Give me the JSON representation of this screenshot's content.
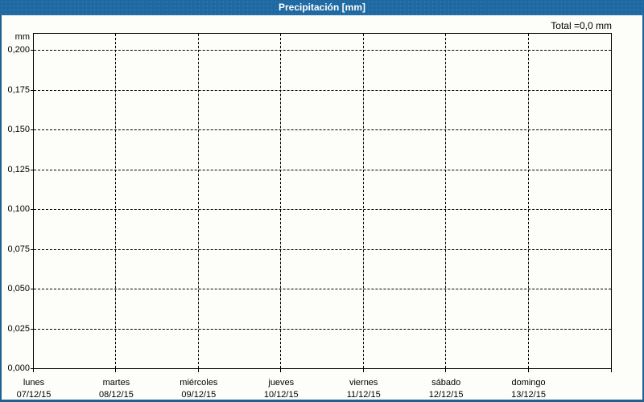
{
  "window": {
    "title": "Precipitación [mm]"
  },
  "summary": {
    "total_label": "Total =0,0 mm"
  },
  "colors": {
    "titlebar": "#1e69a2",
    "frame_border": "#20618f",
    "content_bg": "#fdfdfa",
    "grid": "#000000",
    "title_text": "#ffffff",
    "label_text": "#000000"
  },
  "chart_data": {
    "type": "bar",
    "title": "Precipitación [mm]",
    "ylabel": "mm",
    "xlabel": "",
    "ylim": [
      0,
      0.2
    ],
    "ytick_step": 0.025,
    "ytick_labels": [
      "0,000",
      "0,025",
      "0,050",
      "0,075",
      "0,100",
      "0,125",
      "0,150",
      "0,175",
      "0,200"
    ],
    "categories": [
      "lunes",
      "martes",
      "miércoles",
      "jueves",
      "viernes",
      "sábado",
      "domingo"
    ],
    "category_dates": [
      "07/12/15",
      "08/12/15",
      "09/12/15",
      "10/12/15",
      "11/12/15",
      "12/12/15",
      "13/12/15"
    ],
    "series": [
      {
        "name": "Precipitación",
        "values": [
          0,
          0,
          0,
          0,
          0,
          0,
          0
        ]
      }
    ],
    "total": "0,0 mm",
    "grid": true,
    "legend": false
  }
}
